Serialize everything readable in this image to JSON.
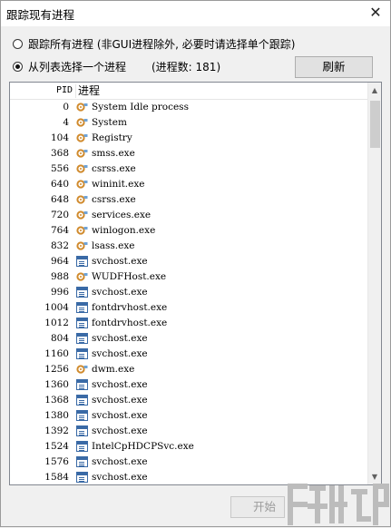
{
  "window": {
    "title": "跟踪现有进程",
    "close_glyph": "✕"
  },
  "options": {
    "trace_all": "跟踪所有进程 (非GUI进程除外, 必要时请选择单个跟踪)",
    "select_one": "从列表选择一个进程",
    "process_count": "(进程数: 181)"
  },
  "buttons": {
    "refresh": "刷新",
    "start": "开始"
  },
  "list": {
    "columns": {
      "pid": "PID",
      "name": "进程"
    },
    "rows": [
      {
        "pid": "0",
        "name": "System Idle process",
        "icon": "gear-app-icon"
      },
      {
        "pid": "4",
        "name": "System",
        "icon": "gear-app-icon"
      },
      {
        "pid": "104",
        "name": "Registry",
        "icon": "gear-app-icon"
      },
      {
        "pid": "368",
        "name": "smss.exe",
        "icon": "gear-app-icon"
      },
      {
        "pid": "556",
        "name": "csrss.exe",
        "icon": "gear-app-icon"
      },
      {
        "pid": "640",
        "name": "wininit.exe",
        "icon": "gear-app-icon"
      },
      {
        "pid": "648",
        "name": "csrss.exe",
        "icon": "gear-app-icon"
      },
      {
        "pid": "720",
        "name": "services.exe",
        "icon": "gear-app-icon"
      },
      {
        "pid": "764",
        "name": "winlogon.exe",
        "icon": "gear-app-icon"
      },
      {
        "pid": "832",
        "name": "lsass.exe",
        "icon": "gear-app-icon"
      },
      {
        "pid": "964",
        "name": "svchost.exe",
        "icon": "window-app-icon"
      },
      {
        "pid": "988",
        "name": "WUDFHost.exe",
        "icon": "gear-app-icon"
      },
      {
        "pid": "996",
        "name": "svchost.exe",
        "icon": "window-app-icon"
      },
      {
        "pid": "1004",
        "name": "fontdrvhost.exe",
        "icon": "window-app-icon"
      },
      {
        "pid": "1012",
        "name": "fontdrvhost.exe",
        "icon": "window-app-icon"
      },
      {
        "pid": "804",
        "name": "svchost.exe",
        "icon": "window-app-icon"
      },
      {
        "pid": "1160",
        "name": "svchost.exe",
        "icon": "window-app-icon"
      },
      {
        "pid": "1256",
        "name": "dwm.exe",
        "icon": "gear-app-icon"
      },
      {
        "pid": "1360",
        "name": "svchost.exe",
        "icon": "window-app-icon"
      },
      {
        "pid": "1368",
        "name": "svchost.exe",
        "icon": "window-app-icon"
      },
      {
        "pid": "1380",
        "name": "svchost.exe",
        "icon": "window-app-icon"
      },
      {
        "pid": "1392",
        "name": "svchost.exe",
        "icon": "window-app-icon"
      },
      {
        "pid": "1524",
        "name": "IntelCpHDCPSvc.exe",
        "icon": "window-app-icon"
      },
      {
        "pid": "1576",
        "name": "svchost.exe",
        "icon": "window-app-icon"
      },
      {
        "pid": "1584",
        "name": "svchost.exe",
        "icon": "window-app-icon"
      }
    ]
  },
  "scrollbar": {
    "up_glyph": "▲",
    "down_glyph": "▼"
  },
  "colors": {
    "gear_icon": "#d08a2c",
    "window_icon": "#3a6aa6",
    "watermark": "#bcbcbc"
  }
}
